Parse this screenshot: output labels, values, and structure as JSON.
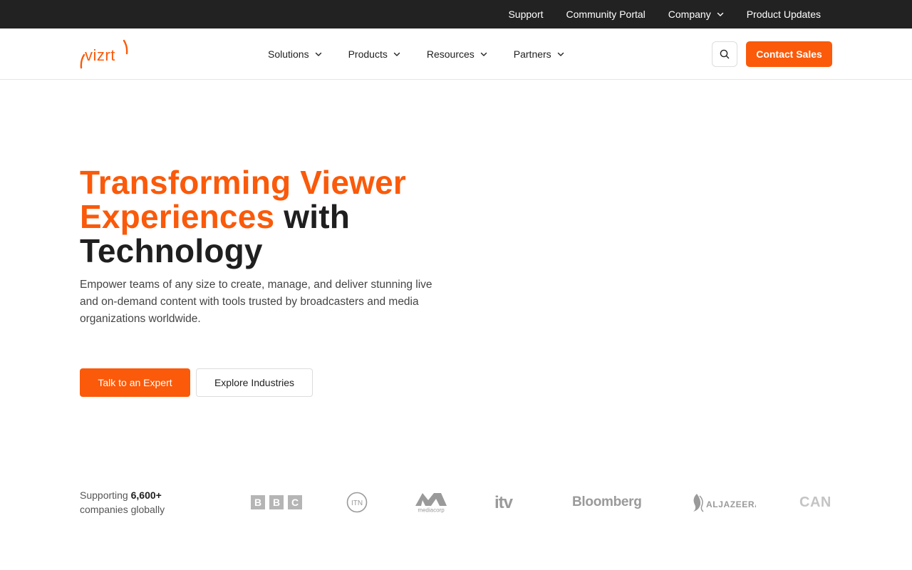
{
  "topbar": {
    "links": [
      {
        "label": "Support"
      },
      {
        "label": "Community Portal"
      },
      {
        "label": "Company",
        "has_dropdown": true
      },
      {
        "label": "Product Updates"
      }
    ]
  },
  "nav": {
    "logo_text": "vizrt",
    "items": [
      {
        "label": "Solutions"
      },
      {
        "label": "Products"
      },
      {
        "label": "Resources"
      },
      {
        "label": "Partners"
      }
    ],
    "search_icon": "search-icon",
    "contact_label": "Contact Sales"
  },
  "hero": {
    "title_accent": "Transforming Viewer Experiences",
    "title_rest": " with Technology",
    "description": "Empower teams of any size to create, manage, and deliver stunning live and on-demand content with tools trusted by broadcasters and media organizations worldwide.",
    "primary_button": "Talk to an Expert",
    "secondary_button": "Explore Industries"
  },
  "trust": {
    "prefix": "Supporting ",
    "count": "6,600+",
    "suffix": "companies globally",
    "logos": [
      {
        "name": "BBC",
        "letters": [
          "B",
          "B",
          "C"
        ]
      },
      {
        "name": "ITN",
        "text": "ITN"
      },
      {
        "name": "mediacorp",
        "text": "mediacorp"
      },
      {
        "name": "itv",
        "text": "itv"
      },
      {
        "name": "Bloomberg",
        "text": "Bloomberg"
      },
      {
        "name": "Al Jazeera",
        "text": "ALJAZEERA"
      },
      {
        "name": "Canal",
        "text": "CAN"
      }
    ]
  },
  "colors": {
    "accent": "#fa5a0a",
    "topbar_bg": "#222222",
    "logo_gray": "#9a9a9a"
  }
}
